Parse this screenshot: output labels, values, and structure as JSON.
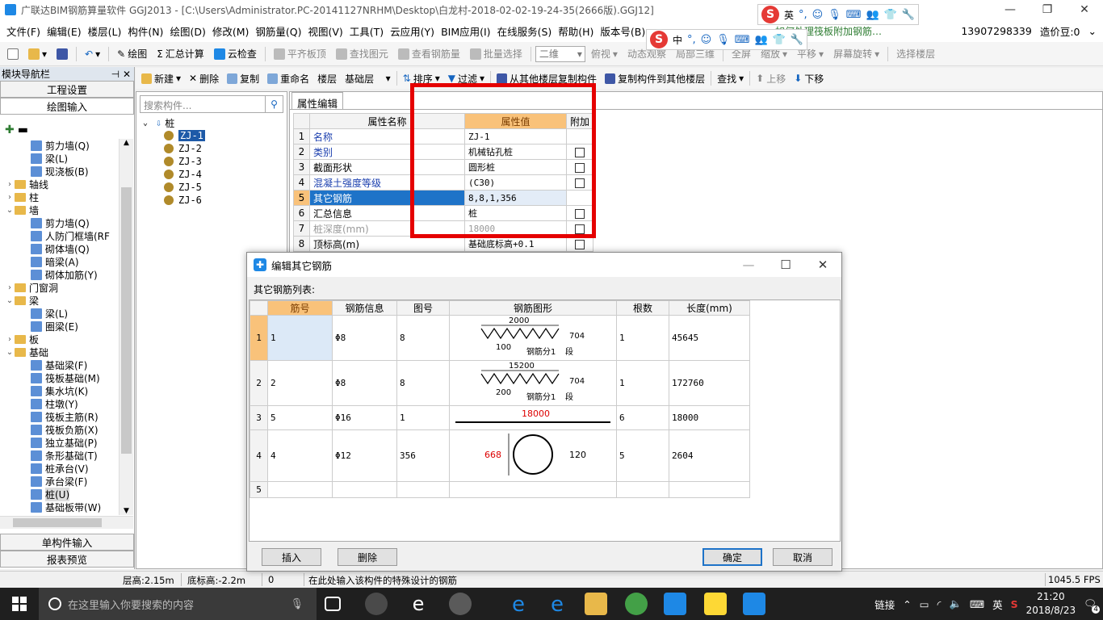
{
  "window": {
    "title": "广联达BIM钢筋算量软件 GGJ2013 - [C:\\Users\\Administrator.PC-20141127NRHM\\Desktop\\白龙村-2018-02-02-19-24-35(2666版).GGJ12]"
  },
  "ime": {
    "logo": "S",
    "lang": "英",
    "lang2": "中"
  },
  "menu": {
    "items": [
      "文件(F)",
      "编辑(E)",
      "楼层(L)",
      "构件(N)",
      "绘图(D)",
      "修改(M)",
      "钢筋量(Q)",
      "视图(V)",
      "工具(T)",
      "云应用(Y)",
      "BIM应用(I)",
      "在线服务(S)",
      "帮助(H)",
      "版本号(B)"
    ],
    "news": "如何处理筏板附加钢筋…",
    "phone": "13907298339",
    "beans": "造价豆:0"
  },
  "toolbar1": {
    "draw": "绘图",
    "sum": "汇总计算",
    "cloud_check": "云检查",
    "flush_slab": "平齐板顶",
    "find_elem": "查找图元",
    "view_rebar": "查看钢筋量",
    "batch_select": "批量选择",
    "view_mode": "二维",
    "top_view": "俯视",
    "dynamic_view": "动态观察",
    "local_3d": "局部三维",
    "fullscreen": "全屏",
    "zoom": "缩放",
    "pan": "平移",
    "rotate": "屏幕旋转",
    "select_floor": "选择楼层"
  },
  "toolbar2": {
    "new": "新建",
    "delete": "删除",
    "copy": "复制",
    "rename": "重命名",
    "floor_label": "楼层",
    "floor_value": "基础层",
    "sort": "排序",
    "filter": "过滤",
    "copy_from": "从其他楼层复制构件",
    "copy_to": "复制构件到其他楼层",
    "find": "查找",
    "move_up": "上移",
    "move_down": "下移"
  },
  "leftnav": {
    "header": "模块导航栏",
    "btn_project": "工程设置",
    "btn_draw": "绘图输入",
    "tree": [
      {
        "indent": 2,
        "type": "leaf",
        "label": "剪力墙(Q)"
      },
      {
        "indent": 2,
        "type": "leaf",
        "label": "梁(L)"
      },
      {
        "indent": 2,
        "type": "leaf",
        "label": "现浇板(B)"
      },
      {
        "indent": 0,
        "type": "folder",
        "exp": "›",
        "label": "轴线"
      },
      {
        "indent": 0,
        "type": "folder",
        "exp": "›",
        "label": "柱"
      },
      {
        "indent": 0,
        "type": "folder",
        "exp": "⌄",
        "label": "墙"
      },
      {
        "indent": 2,
        "type": "leaf",
        "label": "剪力墙(Q)"
      },
      {
        "indent": 2,
        "type": "leaf",
        "label": "人防门框墙(RF"
      },
      {
        "indent": 2,
        "type": "leaf",
        "label": "砌体墙(Q)"
      },
      {
        "indent": 2,
        "type": "leaf",
        "label": "暗梁(A)"
      },
      {
        "indent": 2,
        "type": "leaf",
        "label": "砌体加筋(Y)"
      },
      {
        "indent": 0,
        "type": "folder",
        "exp": "›",
        "label": "门窗洞"
      },
      {
        "indent": 0,
        "type": "folder",
        "exp": "⌄",
        "label": "梁"
      },
      {
        "indent": 2,
        "type": "leaf",
        "label": "梁(L)"
      },
      {
        "indent": 2,
        "type": "leaf",
        "label": "圈梁(E)"
      },
      {
        "indent": 0,
        "type": "folder",
        "exp": "›",
        "label": "板"
      },
      {
        "indent": 0,
        "type": "folder",
        "exp": "⌄",
        "label": "基础"
      },
      {
        "indent": 2,
        "type": "leaf",
        "label": "基础梁(F)"
      },
      {
        "indent": 2,
        "type": "leaf",
        "label": "筏板基础(M)"
      },
      {
        "indent": 2,
        "type": "leaf",
        "label": "集水坑(K)"
      },
      {
        "indent": 2,
        "type": "leaf",
        "label": "柱墩(Y)"
      },
      {
        "indent": 2,
        "type": "leaf",
        "label": "筏板主筋(R)"
      },
      {
        "indent": 2,
        "type": "leaf",
        "label": "筏板负筋(X)"
      },
      {
        "indent": 2,
        "type": "leaf",
        "label": "独立基础(P)"
      },
      {
        "indent": 2,
        "type": "leaf",
        "label": "条形基础(T)"
      },
      {
        "indent": 2,
        "type": "leaf",
        "label": "桩承台(V)"
      },
      {
        "indent": 2,
        "type": "leaf",
        "label": "承台梁(F)"
      },
      {
        "indent": 2,
        "type": "leaf",
        "label": "桩(U)",
        "selected": true
      },
      {
        "indent": 2,
        "type": "leaf",
        "label": "基础板带(W)"
      }
    ],
    "btn_single": "单构件输入",
    "btn_report": "报表预览"
  },
  "complist": {
    "search_placeholder": "搜索构件...",
    "root": "桩",
    "items": [
      "ZJ-1",
      "ZJ-2",
      "ZJ-3",
      "ZJ-4",
      "ZJ-5",
      "ZJ-6"
    ]
  },
  "props": {
    "tab": "属性编辑",
    "headers": {
      "name": "属性名称",
      "value": "属性值",
      "add": "附加"
    },
    "rows": [
      {
        "n": "1",
        "name": "名称",
        "value": "ZJ-1",
        "style": "blue",
        "cb": false
      },
      {
        "n": "2",
        "name": "类别",
        "value": "机械钻孔桩",
        "style": "blue",
        "cb": true
      },
      {
        "n": "3",
        "name": "截面形状",
        "value": "圆形桩",
        "style": "",
        "cb": true
      },
      {
        "n": "4",
        "name": "混凝土强度等级",
        "value": "(C30)",
        "style": "blue",
        "cb": true
      },
      {
        "n": "5",
        "name": "其它钢筋",
        "value": "8,8,1,356",
        "style": "sel",
        "cb": false
      },
      {
        "n": "6",
        "name": "汇总信息",
        "value": "桩",
        "style": "",
        "cb": true
      },
      {
        "n": "7",
        "name": "桩深度(mm)",
        "value": "18000",
        "style": "gray",
        "cb": true
      },
      {
        "n": "8",
        "name": "顶标高(m)",
        "value": "基础底标高+0.1",
        "style": "",
        "cb": true
      }
    ]
  },
  "dialog": {
    "title": "编辑其它钢筋",
    "sublabel": "其它钢筋列表:",
    "headers": [
      "筋号",
      "钢筋信息",
      "图号",
      "钢筋图形",
      "根数",
      "长度(mm)"
    ],
    "rows": [
      {
        "n": "1",
        "bar": "1",
        "info": "Φ8",
        "fig": "8",
        "shape": "zigzag",
        "top": "2000",
        "bottom": "100",
        "right": "704",
        "note": "钢筋分1",
        "note2": "段",
        "count": "1",
        "length": "45645"
      },
      {
        "n": "2",
        "bar": "2",
        "info": "Φ8",
        "fig": "8",
        "shape": "zigzag",
        "top": "15200",
        "bottom": "200",
        "right": "704",
        "note": "钢筋分1",
        "note2": "段",
        "count": "1",
        "length": "172760"
      },
      {
        "n": "3",
        "bar": "5",
        "info": "Φ16",
        "fig": "1",
        "shape": "straight",
        "top": "18000",
        "count": "6",
        "length": "18000"
      },
      {
        "n": "4",
        "bar": "4",
        "info": "Φ12",
        "fig": "356",
        "shape": "circle",
        "left": "668",
        "right": "120",
        "count": "5",
        "length": "2604"
      },
      {
        "n": "5",
        "bar": "",
        "info": "",
        "fig": "",
        "shape": "",
        "count": "",
        "length": ""
      }
    ],
    "btn_insert": "插入",
    "btn_delete": "删除",
    "btn_ok": "确定",
    "btn_cancel": "取消"
  },
  "status": {
    "floor_height": "层高:2.15m",
    "bottom_elev": "底标高:-2.2m",
    "zero": "0",
    "hint": "在此处输入该构件的特殊设计的钢筋",
    "fps": "1045.5 FPS"
  },
  "taskbar": {
    "search_placeholder": "在这里输入你要搜索的内容",
    "link": "链接",
    "ime": "英",
    "time": "21:20",
    "date": "2018/8/23",
    "badge": "4"
  },
  "colors": {
    "accent": "#1e73c8",
    "header_orange": "#f9c27a",
    "highlight_red": "#e50000"
  }
}
